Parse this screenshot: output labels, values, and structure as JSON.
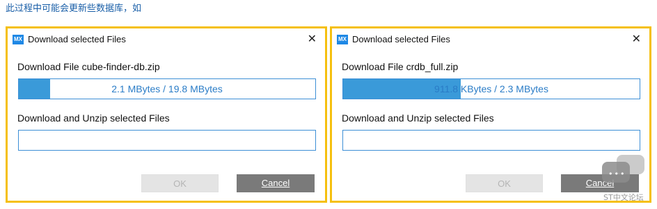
{
  "caption": "此过程中可能会更新些数据库，如",
  "dialogs": [
    {
      "icon": "MX",
      "title": "Download selected Files",
      "close": "✕",
      "download_label": "Download File cube-finder-db.zip",
      "progress_text": "2.1 MBytes / 19.8 MBytes",
      "progress_fraction": 0.106,
      "unzip_label": "Download and Unzip selected Files",
      "ok_label": "OK",
      "cancel_label": "Cancel"
    },
    {
      "icon": "MX",
      "title": "Download selected Files",
      "close": "✕",
      "download_label": "Download File crdb_full.zip",
      "progress_text": "911.8 KBytes / 2.3 MBytes",
      "progress_fraction": 0.396,
      "unzip_label": "Download and Unzip selected Files",
      "ok_label": "OK",
      "cancel_label": "Cancel"
    }
  ],
  "watermark": {
    "dots": "•••",
    "text": "ST中文论坛"
  },
  "colors": {
    "highlight_border": "#f5c00f",
    "progress_fill": "#3a9ad9",
    "cancel_bg": "#7a7a7a",
    "caption_text": "#1a5fa8"
  }
}
